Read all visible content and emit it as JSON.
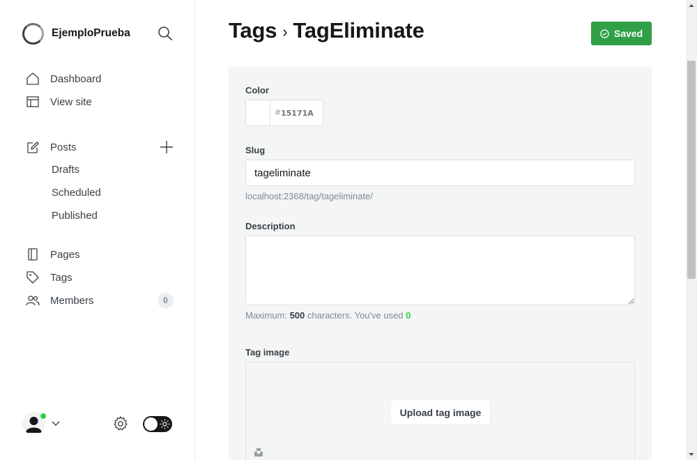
{
  "brand": {
    "name": "EjemploPrueba",
    "logo_icon": "site-logo-ring"
  },
  "sidebar": {
    "primary": [
      {
        "label": "Dashboard",
        "icon": "home-icon"
      },
      {
        "label": "View site",
        "icon": "layout-icon"
      }
    ],
    "posts": {
      "label": "Posts",
      "icon": "pencil-icon",
      "sub_items": [
        "Drafts",
        "Scheduled",
        "Published"
      ]
    },
    "secondary": [
      {
        "label": "Pages",
        "icon": "page-icon"
      },
      {
        "label": "Tags",
        "icon": "tag-icon"
      },
      {
        "label": "Members",
        "icon": "members-icon",
        "count": "0"
      }
    ]
  },
  "header": {
    "breadcrumb_parent": "Tags",
    "breadcrumb_separator": "›",
    "title": "TagEliminate",
    "status_button": "Saved"
  },
  "form": {
    "color": {
      "label": "Color",
      "hash": "#",
      "placeholder": "15171A",
      "value": ""
    },
    "slug": {
      "label": "Slug",
      "value": "tageliminate",
      "url": "localhost:2368/tag/tageliminate/"
    },
    "description": {
      "label": "Description",
      "value": "",
      "hint_prefix": "Maximum:",
      "max": "500",
      "hint_middle": "characters. You've used",
      "used": "0"
    },
    "tag_image": {
      "label": "Tag image",
      "upload_label": "Upload tag image"
    }
  },
  "colors": {
    "accent_green": "#30a046",
    "online_dot": "#30cf43",
    "text_dark": "#15171a",
    "panel_bg": "#f4f5f5"
  }
}
